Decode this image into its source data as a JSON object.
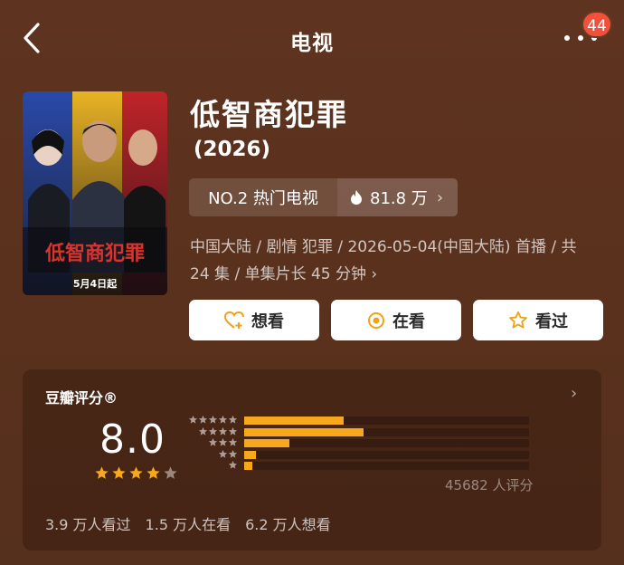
{
  "header": {
    "title": "电视",
    "back_icon": "chevron-left-icon",
    "more_icon": "more-dots-icon",
    "notification_count": "44"
  },
  "poster": {
    "title_text": "低智商犯罪",
    "date_text": "5月4日起"
  },
  "show": {
    "title": "低智商犯罪",
    "year": "(2026)",
    "rank_label": "NO.2 热门电视",
    "heat_value": "81.8 万",
    "meta_line1": "中国大陆 / 剧情 犯罪 / 2026-05-04(中国大陆) 首播 / 共",
    "meta_line2": "24 集 / 单集片长 45 分钟"
  },
  "actions": [
    {
      "label": "想看",
      "icon": "heart-plus-icon"
    },
    {
      "label": "在看",
      "icon": "watching-circle-icon"
    },
    {
      "label": "看过",
      "icon": "star-outline-icon"
    }
  ],
  "rating": {
    "title": "豆瓣评分®",
    "score": "8.0",
    "stars_filled": 4,
    "stars_total": 5,
    "count_text": "45682 人评分",
    "distribution": [
      {
        "stars": 5,
        "fraction": 0.35
      },
      {
        "stars": 4,
        "fraction": 0.42
      },
      {
        "stars": 3,
        "fraction": 0.16
      },
      {
        "stars": 2,
        "fraction": 0.04
      },
      {
        "stars": 1,
        "fraction": 0.03
      }
    ],
    "colors": {
      "bar": "#f7a81c",
      "star": "#f7a81c"
    }
  },
  "stats": {
    "watched": "3.9 万人看过",
    "watching": "1.5 万人在看",
    "want": "6.2 万人想看"
  }
}
